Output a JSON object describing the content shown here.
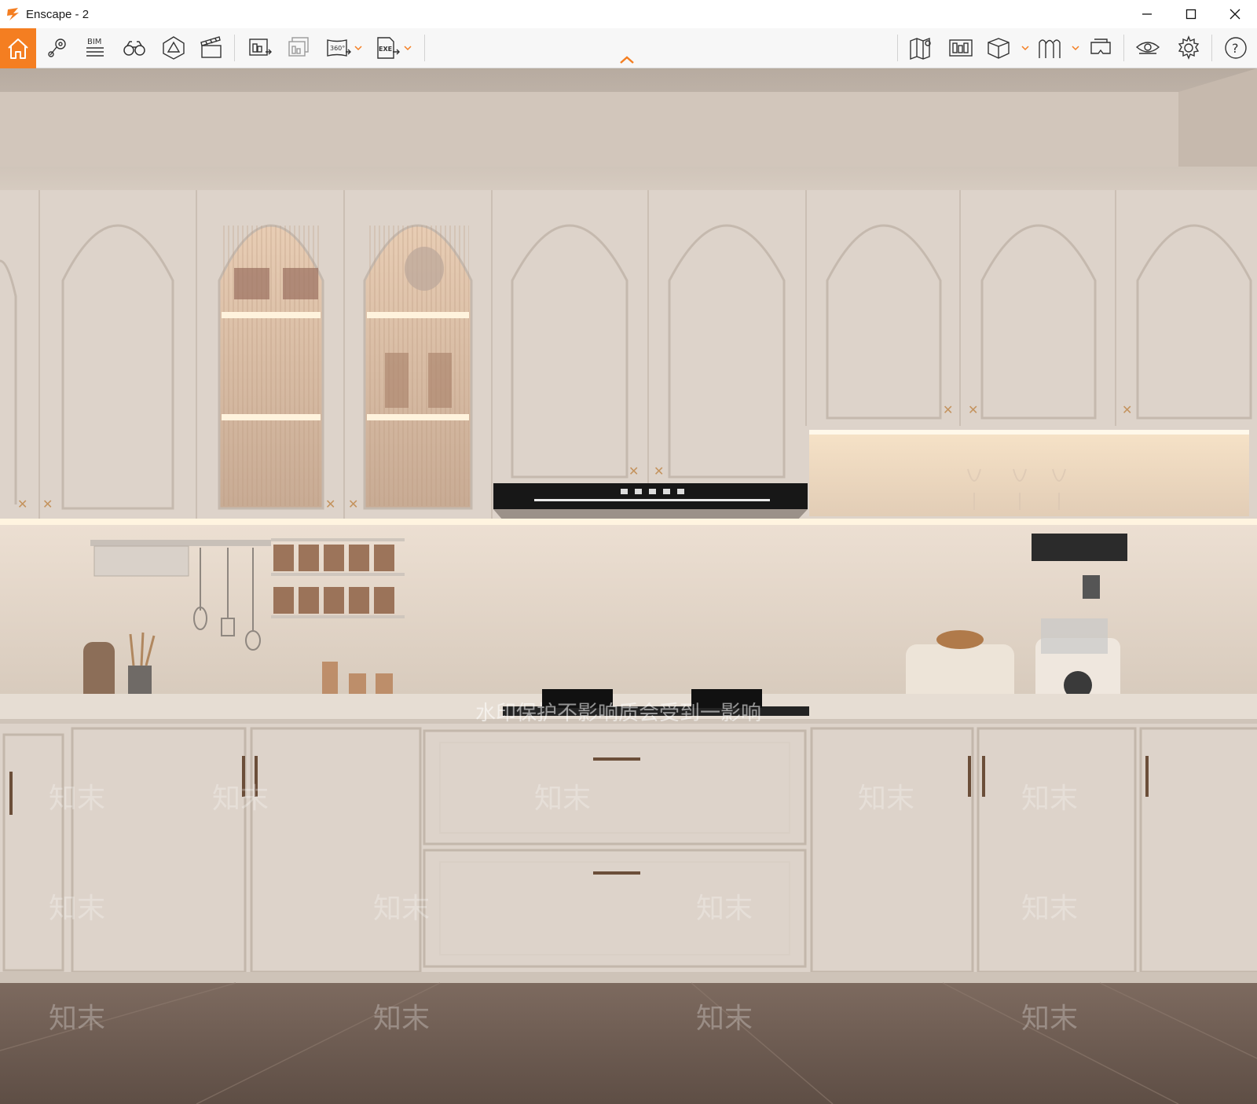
{
  "window": {
    "title": "Enscape - 2",
    "controls": {
      "minimize_icon": "minimize-icon",
      "maximize_icon": "maximize-icon",
      "close_icon": "close-icon"
    }
  },
  "toolbar": {
    "accent_color": "#f47e21",
    "left_tools": [
      {
        "name": "home",
        "icon": "home-icon"
      },
      {
        "name": "views",
        "icon": "location-pin-icon"
      },
      {
        "name": "bim",
        "icon": "bim-icon",
        "label": "BIM"
      },
      {
        "name": "binoculars",
        "icon": "binoculars-icon"
      },
      {
        "name": "asset-library",
        "icon": "asset-library-icon"
      },
      {
        "name": "video-editor",
        "icon": "clapperboard-icon"
      },
      {
        "name": "render-image",
        "icon": "render-image-icon"
      },
      {
        "name": "batch-render",
        "icon": "batch-render-icon"
      },
      {
        "name": "panorama",
        "icon": "panorama-360-icon",
        "label": "360°"
      },
      {
        "name": "export-exe",
        "icon": "export-exe-icon",
        "label": "EXE"
      }
    ],
    "right_tools": [
      {
        "name": "map",
        "icon": "map-icon"
      },
      {
        "name": "views-manager",
        "icon": "views-manager-icon"
      },
      {
        "name": "material-editor",
        "icon": "cube-icon"
      },
      {
        "name": "atmosphere",
        "icon": "atmosphere-icon"
      },
      {
        "name": "vr-headset",
        "icon": "vr-headset-icon"
      },
      {
        "name": "visual-settings",
        "icon": "eye-icon"
      },
      {
        "name": "general-settings",
        "icon": "gear-icon"
      },
      {
        "name": "help",
        "icon": "help-icon",
        "label": "?"
      }
    ],
    "collapse_icon": "chevron-up-icon"
  },
  "viewport": {
    "scene": "kitchen-render",
    "watermark_center": "水印保护不影响质会受到一影响",
    "watermark_repeat": "知末"
  }
}
